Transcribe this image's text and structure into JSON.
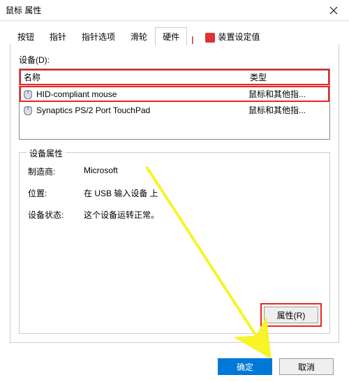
{
  "window": {
    "title": "鼠标 属性"
  },
  "tabs": [
    {
      "label": "按钮"
    },
    {
      "label": "指针"
    },
    {
      "label": "指针选项"
    },
    {
      "label": "滑轮"
    },
    {
      "label": "硬件",
      "active": true
    },
    {
      "label": "装置设定值",
      "icon": true
    }
  ],
  "device_section": {
    "heading": "设备(D):",
    "columns": {
      "name": "名称",
      "type": "类型"
    },
    "rows": [
      {
        "name": "HID-compliant mouse",
        "type": "鼠标和其他指...",
        "highlight": true
      },
      {
        "name": "Synaptics PS/2 Port TouchPad",
        "type": "鼠标和其他指..."
      }
    ]
  },
  "properties": {
    "legend": "设备属性",
    "rows": {
      "manufacturer": {
        "label": "制造商:",
        "value": "Microsoft"
      },
      "location": {
        "label": "位置:",
        "value": "在 USB 输入设备 上"
      },
      "status": {
        "label": "设备状态:",
        "value": "这个设备运转正常。"
      }
    },
    "button": "属性(R)"
  },
  "buttons": {
    "ok": "确定",
    "cancel": "取消"
  }
}
